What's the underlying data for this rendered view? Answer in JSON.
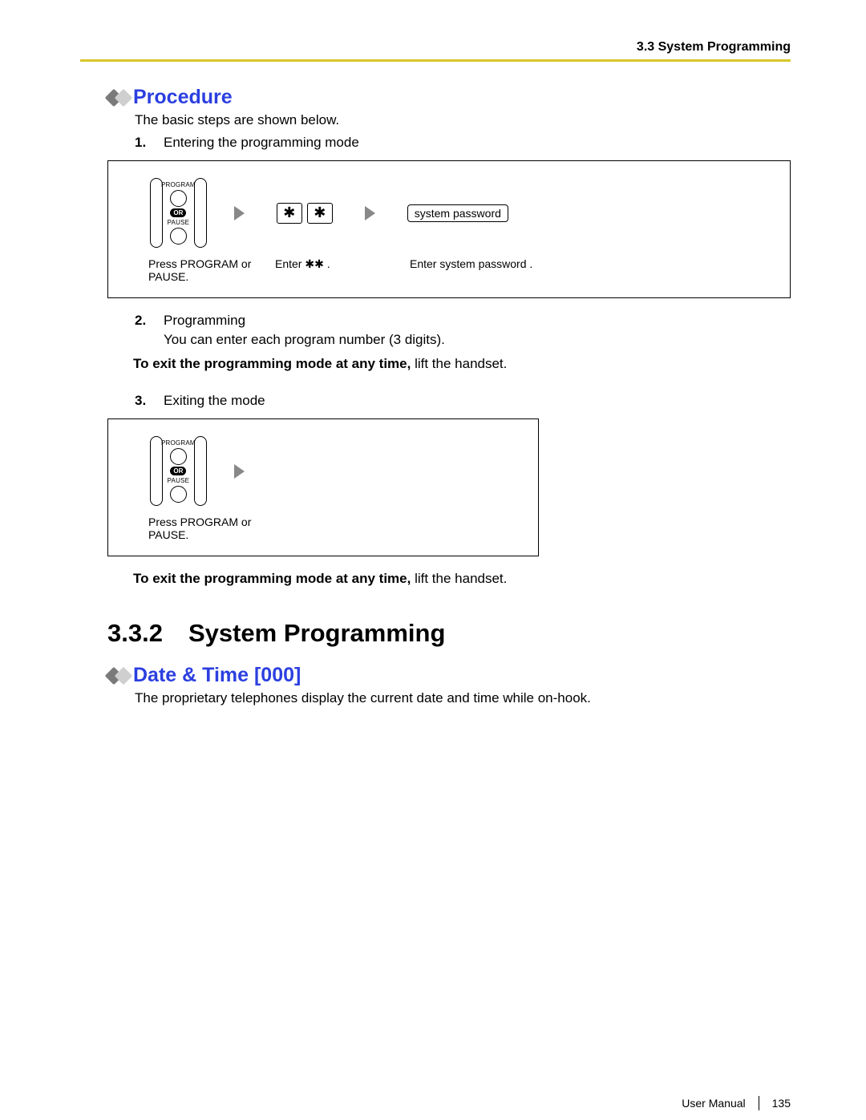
{
  "header": {
    "section_label": "3.3 System Programming"
  },
  "procedure": {
    "title": "Procedure",
    "intro": "The basic steps are shown below.",
    "items": [
      {
        "num": "1.",
        "text": "Entering the programming mode"
      },
      {
        "num": "2.",
        "text": "Programming"
      },
      {
        "num": "3.",
        "text": "Exiting the mode"
      }
    ],
    "sub_after_2": "You can enter each program number (3 digits).",
    "flow1": {
      "btn_top": "PROGRAM",
      "or": "OR",
      "btn_bottom": "PAUSE",
      "star": "✱",
      "syspass": "system password",
      "cap1": "Press PROGRAM or PAUSE.",
      "cap2": "Enter ✱✱ .",
      "cap3": "Enter system password  ."
    },
    "flow2": {
      "btn_top": "PROGRAM",
      "or": "OR",
      "btn_bottom": "PAUSE",
      "cap1": "Press PROGRAM or PAUSE."
    },
    "note_bold": "To exit the programming mode at any time,",
    "note_rest": " lift the handset."
  },
  "section332": {
    "num": "3.3.2",
    "title": "System Programming"
  },
  "datetime": {
    "title": "Date & Time [000]",
    "body": "The proprietary telephones display the current date and time while on-hook."
  },
  "footer": {
    "manual": "User Manual",
    "page": "135"
  }
}
